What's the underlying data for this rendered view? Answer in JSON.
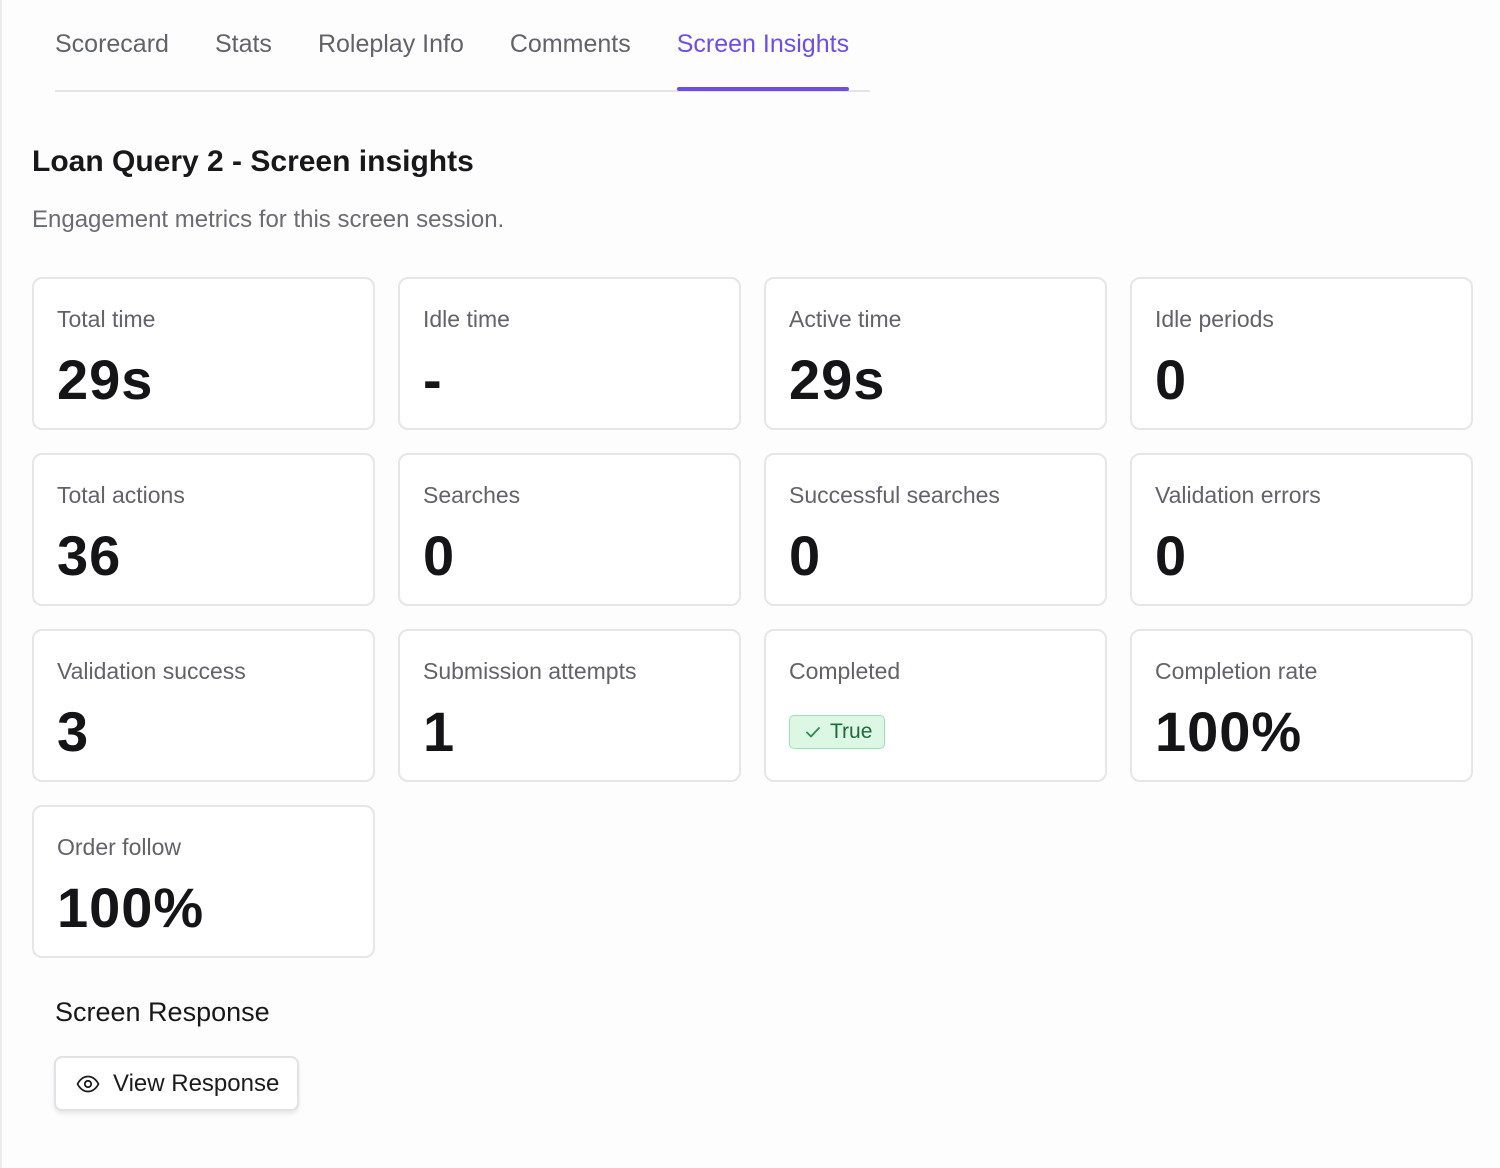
{
  "tabs": [
    {
      "label": "Scorecard",
      "active": false
    },
    {
      "label": "Stats",
      "active": false
    },
    {
      "label": "Roleplay Info",
      "active": false
    },
    {
      "label": "Comments",
      "active": false
    },
    {
      "label": "Screen Insights",
      "active": true
    }
  ],
  "header": {
    "title": "Loan Query 2 - Screen insights",
    "subtitle": "Engagement metrics for this screen session."
  },
  "metrics": [
    {
      "label": "Total time",
      "value": "29s"
    },
    {
      "label": "Idle time",
      "value": "-"
    },
    {
      "label": "Active time",
      "value": "29s"
    },
    {
      "label": "Idle periods",
      "value": "0"
    },
    {
      "label": "Total actions",
      "value": "36"
    },
    {
      "label": "Searches",
      "value": "0"
    },
    {
      "label": "Successful searches",
      "value": "0"
    },
    {
      "label": "Validation errors",
      "value": "0"
    },
    {
      "label": "Validation success",
      "value": "3"
    },
    {
      "label": "Submission attempts",
      "value": "1"
    },
    {
      "label": "Completed",
      "badge": "True",
      "badge_icon": "check-icon",
      "badge_color": "#dcf7e4"
    },
    {
      "label": "Completion rate",
      "value": "100%"
    },
    {
      "label": "Order follow",
      "value": "100%"
    }
  ],
  "response": {
    "heading": "Screen Response",
    "button_label": "View Response",
    "button_icon": "eye-icon"
  },
  "colors": {
    "accent": "#6d4ee6",
    "success_bg": "#dcf7e4",
    "success_text": "#1d6b3b"
  }
}
